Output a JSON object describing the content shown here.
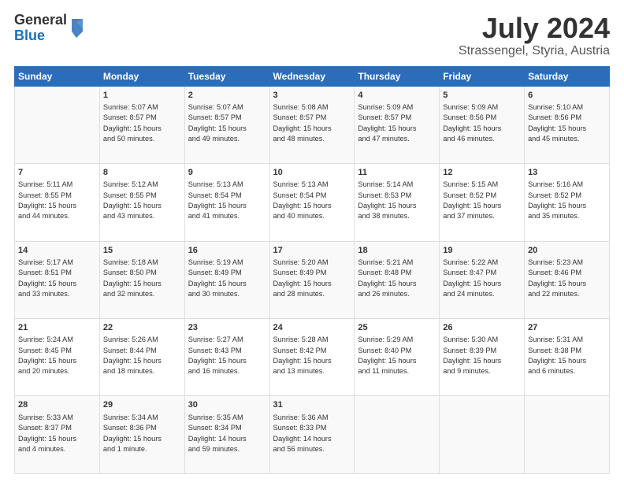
{
  "logo": {
    "general": "General",
    "blue": "Blue"
  },
  "title": "July 2024",
  "subtitle": "Strassengel, Styria, Austria",
  "calendar": {
    "headers": [
      "Sunday",
      "Monday",
      "Tuesday",
      "Wednesday",
      "Thursday",
      "Friday",
      "Saturday"
    ],
    "rows": [
      [
        {
          "day": "",
          "content": ""
        },
        {
          "day": "1",
          "content": "Sunrise: 5:07 AM\nSunset: 8:57 PM\nDaylight: 15 hours\nand 50 minutes."
        },
        {
          "day": "2",
          "content": "Sunrise: 5:07 AM\nSunset: 8:57 PM\nDaylight: 15 hours\nand 49 minutes."
        },
        {
          "day": "3",
          "content": "Sunrise: 5:08 AM\nSunset: 8:57 PM\nDaylight: 15 hours\nand 48 minutes."
        },
        {
          "day": "4",
          "content": "Sunrise: 5:09 AM\nSunset: 8:57 PM\nDaylight: 15 hours\nand 47 minutes."
        },
        {
          "day": "5",
          "content": "Sunrise: 5:09 AM\nSunset: 8:56 PM\nDaylight: 15 hours\nand 46 minutes."
        },
        {
          "day": "6",
          "content": "Sunrise: 5:10 AM\nSunset: 8:56 PM\nDaylight: 15 hours\nand 45 minutes."
        }
      ],
      [
        {
          "day": "7",
          "content": "Sunrise: 5:11 AM\nSunset: 8:55 PM\nDaylight: 15 hours\nand 44 minutes."
        },
        {
          "day": "8",
          "content": "Sunrise: 5:12 AM\nSunset: 8:55 PM\nDaylight: 15 hours\nand 43 minutes."
        },
        {
          "day": "9",
          "content": "Sunrise: 5:13 AM\nSunset: 8:54 PM\nDaylight: 15 hours\nand 41 minutes."
        },
        {
          "day": "10",
          "content": "Sunrise: 5:13 AM\nSunset: 8:54 PM\nDaylight: 15 hours\nand 40 minutes."
        },
        {
          "day": "11",
          "content": "Sunrise: 5:14 AM\nSunset: 8:53 PM\nDaylight: 15 hours\nand 38 minutes."
        },
        {
          "day": "12",
          "content": "Sunrise: 5:15 AM\nSunset: 8:52 PM\nDaylight: 15 hours\nand 37 minutes."
        },
        {
          "day": "13",
          "content": "Sunrise: 5:16 AM\nSunset: 8:52 PM\nDaylight: 15 hours\nand 35 minutes."
        }
      ],
      [
        {
          "day": "14",
          "content": "Sunrise: 5:17 AM\nSunset: 8:51 PM\nDaylight: 15 hours\nand 33 minutes."
        },
        {
          "day": "15",
          "content": "Sunrise: 5:18 AM\nSunset: 8:50 PM\nDaylight: 15 hours\nand 32 minutes."
        },
        {
          "day": "16",
          "content": "Sunrise: 5:19 AM\nSunset: 8:49 PM\nDaylight: 15 hours\nand 30 minutes."
        },
        {
          "day": "17",
          "content": "Sunrise: 5:20 AM\nSunset: 8:49 PM\nDaylight: 15 hours\nand 28 minutes."
        },
        {
          "day": "18",
          "content": "Sunrise: 5:21 AM\nSunset: 8:48 PM\nDaylight: 15 hours\nand 26 minutes."
        },
        {
          "day": "19",
          "content": "Sunrise: 5:22 AM\nSunset: 8:47 PM\nDaylight: 15 hours\nand 24 minutes."
        },
        {
          "day": "20",
          "content": "Sunrise: 5:23 AM\nSunset: 8:46 PM\nDaylight: 15 hours\nand 22 minutes."
        }
      ],
      [
        {
          "day": "21",
          "content": "Sunrise: 5:24 AM\nSunset: 8:45 PM\nDaylight: 15 hours\nand 20 minutes."
        },
        {
          "day": "22",
          "content": "Sunrise: 5:26 AM\nSunset: 8:44 PM\nDaylight: 15 hours\nand 18 minutes."
        },
        {
          "day": "23",
          "content": "Sunrise: 5:27 AM\nSunset: 8:43 PM\nDaylight: 15 hours\nand 16 minutes."
        },
        {
          "day": "24",
          "content": "Sunrise: 5:28 AM\nSunset: 8:42 PM\nDaylight: 15 hours\nand 13 minutes."
        },
        {
          "day": "25",
          "content": "Sunrise: 5:29 AM\nSunset: 8:40 PM\nDaylight: 15 hours\nand 11 minutes."
        },
        {
          "day": "26",
          "content": "Sunrise: 5:30 AM\nSunset: 8:39 PM\nDaylight: 15 hours\nand 9 minutes."
        },
        {
          "day": "27",
          "content": "Sunrise: 5:31 AM\nSunset: 8:38 PM\nDaylight: 15 hours\nand 6 minutes."
        }
      ],
      [
        {
          "day": "28",
          "content": "Sunrise: 5:33 AM\nSunset: 8:37 PM\nDaylight: 15 hours\nand 4 minutes."
        },
        {
          "day": "29",
          "content": "Sunrise: 5:34 AM\nSunset: 8:36 PM\nDaylight: 15 hours\nand 1 minute."
        },
        {
          "day": "30",
          "content": "Sunrise: 5:35 AM\nSunset: 8:34 PM\nDaylight: 14 hours\nand 59 minutes."
        },
        {
          "day": "31",
          "content": "Sunrise: 5:36 AM\nSunset: 8:33 PM\nDaylight: 14 hours\nand 56 minutes."
        },
        {
          "day": "",
          "content": ""
        },
        {
          "day": "",
          "content": ""
        },
        {
          "day": "",
          "content": ""
        }
      ]
    ]
  }
}
